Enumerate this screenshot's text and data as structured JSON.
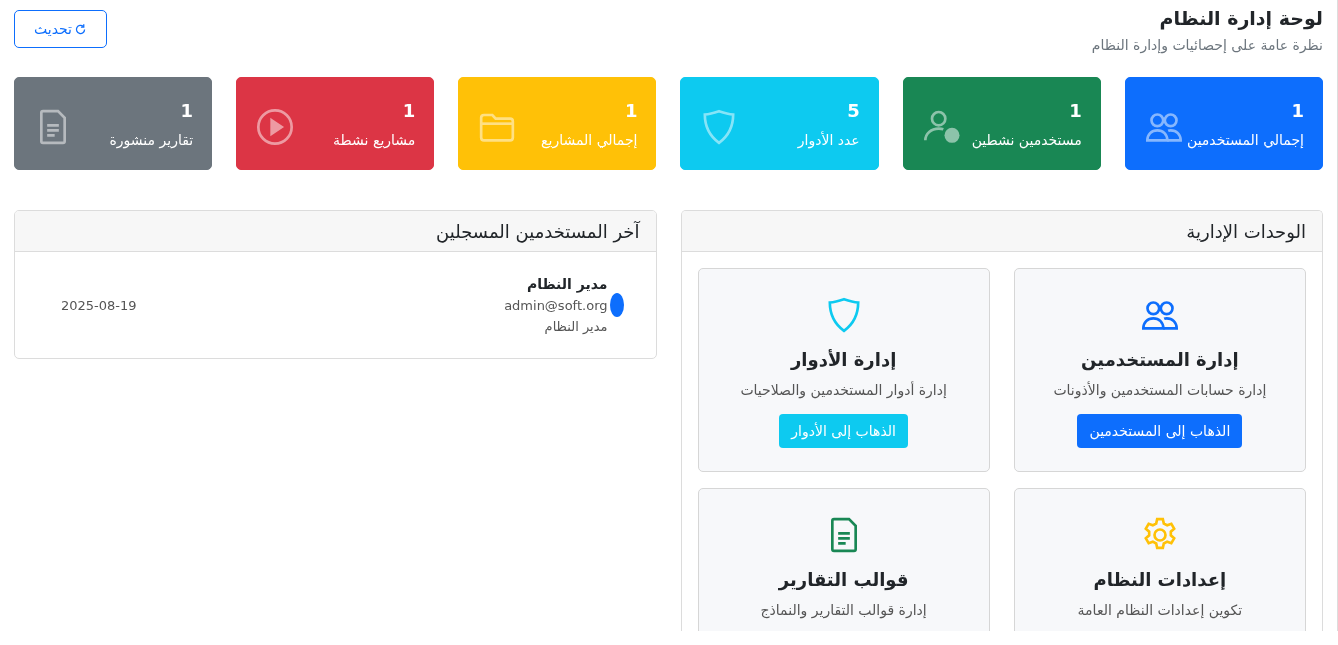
{
  "header": {
    "title": "لوحة إدارة النظام",
    "subtitle": "نظرة عامة على إحصائيات وإدارة النظام",
    "refresh_button": "تحديث"
  },
  "stats": [
    {
      "value": "1",
      "label": "إجمالي المستخدمين",
      "color": "#0d6efd",
      "kind": "users"
    },
    {
      "value": "1",
      "label": "مستخدمين نشطين",
      "color": "#198754",
      "kind": "person-check"
    },
    {
      "value": "5",
      "label": "عدد الأدوار",
      "color": "#0dcaf0",
      "kind": "shield"
    },
    {
      "value": "1",
      "label": "إجمالي المشاريع",
      "color": "#ffc107",
      "kind": "folder"
    },
    {
      "value": "1",
      "label": "مشاريع نشطة",
      "color": "#dc3545",
      "kind": "play"
    },
    {
      "value": "1",
      "label": "تقارير منشورة",
      "color": "#6c757d",
      "kind": "document"
    }
  ],
  "modules_panel": {
    "title": "الوحدات الإدارية",
    "modules": [
      {
        "title": "إدارة المستخدمين",
        "description": "إدارة حسابات المستخدمين والأذونات",
        "button": "الذهاب إلى المستخدمين",
        "color": "#0d6efd",
        "kind": "users"
      },
      {
        "title": "إدارة الأدوار",
        "description": "إدارة أدوار المستخدمين والصلاحيات",
        "button": "الذهاب إلى الأدوار",
        "color": "#0dcaf0",
        "kind": "shield"
      },
      {
        "title": "إعدادات النظام",
        "description": "تكوين إعدادات النظام العامة",
        "color": "#ffc107",
        "kind": "gear"
      },
      {
        "title": "قوالب التقارير",
        "description": "إدارة قوالب التقارير والنماذج",
        "color": "#198754",
        "kind": "document"
      }
    ]
  },
  "recent_users_panel": {
    "title": "آخر المستخدمين المسجلين",
    "users": [
      {
        "name": "مدير النظام",
        "email": "admin@soft.org",
        "role": "مدير النظام",
        "date": "2025-08-19"
      }
    ]
  }
}
